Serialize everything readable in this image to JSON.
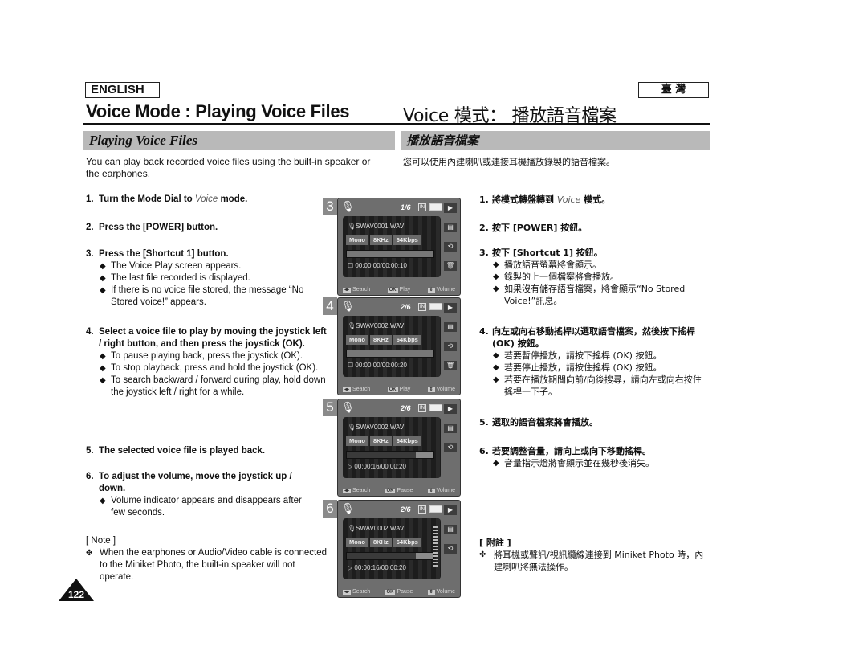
{
  "left": {
    "language_label": "ENGLISH",
    "title": "Voice Mode : Playing Voice Files",
    "section_heading": "Playing Voice Files",
    "intro": "You can play back recorded voice files using the built-in speaker or the earphones.",
    "steps": [
      {
        "num": "1.",
        "pre": "Turn the Mode Dial to ",
        "em": "Voice",
        "post": " mode.",
        "bullets": []
      },
      {
        "num": "2.",
        "text": "Press the [POWER] button.",
        "bullets": []
      },
      {
        "num": "3.",
        "text": "Press the [Shortcut 1] button.",
        "bullets": [
          "The Voice Play screen appears.",
          "The last file recorded is displayed.",
          "If there is no voice file stored, the message “No Stored voice!” appears."
        ]
      },
      {
        "num": "4.",
        "text": "Select a voice file to play by moving the joystick left / right button, and then press the joystick (OK).",
        "bullets": [
          "To pause playing back, press the joystick (OK).",
          "To stop playback, press and hold the joystick (OK).",
          "To search backward / forward during play, hold down the joystick left / right for a while."
        ]
      },
      {
        "num": "5.",
        "text": "The selected voice file is played back.",
        "bullets": []
      },
      {
        "num": "6.",
        "text": "To adjust the volume, move the joystick up / down.",
        "bullets": [
          "Volume indicator appears and disappears after few seconds."
        ]
      }
    ],
    "note": {
      "title": "[ Note ]",
      "bullet_glyph": "✤",
      "text": "When the earphones or Audio/Video cable is connected to the Miniket Photo, the built-in speaker will not operate."
    },
    "page_number": "122"
  },
  "right": {
    "language_label": "臺 灣",
    "title": "Voice 模式： 播放語音檔案",
    "section_heading": "播放語音檔案",
    "intro": "您可以使用內建喇叭或連接耳機播放錄製的語音檔案。",
    "steps": [
      {
        "num": "1.",
        "pre": "將模式轉盤轉到 ",
        "em": "Voice",
        "post": " 模式。",
        "bullets": []
      },
      {
        "num": "2.",
        "text": "按下 [POWER] 按鈕。",
        "bullets": []
      },
      {
        "num": "3.",
        "text": "按下 [Shortcut 1] 按鈕。",
        "bullets": [
          "播放語音螢幕將會顯示。",
          "錄製的上一個檔案將會播放。",
          "如果沒有儲存語音檔案，將會顯示“No Stored Voice!”訊息。"
        ]
      },
      {
        "num": "4.",
        "text": "向左或向右移動搖桿以選取語音檔案，然後按下搖桿 (OK) 按鈕。",
        "bullets": [
          "若要暫停播放，請按下搖桿 (OK) 按鈕。",
          "若要停止播放，請按住搖桿 (OK) 按鈕。",
          "若要在播放期間向前/向後搜尋，請向左或向右按住搖桿一下子。"
        ]
      },
      {
        "num": "5.",
        "text": "選取的語音檔案將會播放。",
        "bullets": []
      },
      {
        "num": "6.",
        "text": "若要調整音量，請向上或向下移動搖桿。",
        "bullets": [
          "音量指示燈將會顯示並在幾秒後消失。"
        ]
      }
    ],
    "note": {
      "title": "[ 附註 ]",
      "bullet_glyph": "✤",
      "text": "將耳機或聲訊/視訊纜線連接到 Miniket Photo 時，內建喇叭將無法操作。"
    }
  },
  "bullet_glyph": "◆",
  "screens": [
    {
      "step": "3",
      "counter": "1/6",
      "storage": "IN",
      "file": "SWAV0001.WAV",
      "tags": [
        "Mono",
        "8KHz",
        "64Kbps"
      ],
      "progress": 0,
      "status_icon": "stop",
      "time": "00:00:00/00:00:10",
      "footer": [
        "Search",
        "Play",
        "Volume"
      ],
      "ok_label": "OK",
      "volume_visible": false,
      "delete_visible": true
    },
    {
      "step": "4",
      "counter": "2/6",
      "storage": "IN",
      "file": "SWAV0002.WAV",
      "tags": [
        "Mono",
        "8KHz",
        "64Kbps"
      ],
      "progress": 0,
      "status_icon": "stop",
      "time": "00:00:00/00:00:20",
      "footer": [
        "Search",
        "Play",
        "Volume"
      ],
      "ok_label": "OK",
      "volume_visible": false,
      "delete_visible": true
    },
    {
      "step": "5",
      "counter": "2/6",
      "storage": "IN",
      "file": "SWAV0002.WAV",
      "tags": [
        "Mono",
        "8KHz",
        "64Kbps"
      ],
      "progress": 0.8,
      "status_icon": "play",
      "time": "00:00:16/00:00:20",
      "footer": [
        "Search",
        "Pause",
        "Volume"
      ],
      "ok_label": "OK",
      "volume_visible": false,
      "delete_visible": false
    },
    {
      "step": "6",
      "counter": "2/6",
      "storage": "IN",
      "file": "SWAV0002.WAV",
      "tags": [
        "Mono",
        "8KHz",
        "64Kbps"
      ],
      "progress": 0.8,
      "status_icon": "play",
      "time": "00:00:16/00:00:20",
      "footer": [
        "Search",
        "Pause",
        "Volume"
      ],
      "ok_label": "OK",
      "volume_visible": true,
      "delete_visible": false
    }
  ]
}
